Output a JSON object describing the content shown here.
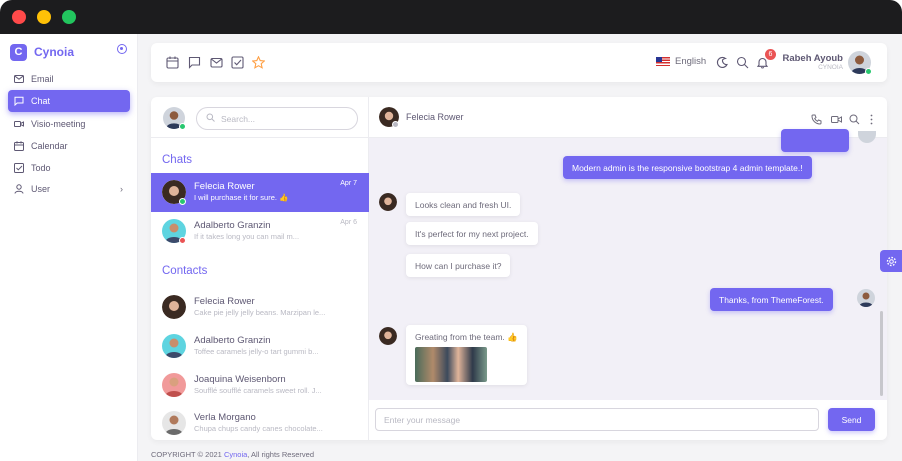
{
  "sidebar": {
    "brand": "Cynoia",
    "brand_mark": "C",
    "items": [
      {
        "label": "Email",
        "icon": "mail-icon"
      },
      {
        "label": "Chat",
        "icon": "chat-icon"
      },
      {
        "label": "Visio-meeting",
        "icon": "video-icon"
      },
      {
        "label": "Calendar",
        "icon": "calendar-icon"
      },
      {
        "label": "Todo",
        "icon": "check-square-icon"
      },
      {
        "label": "User",
        "icon": "user-icon"
      }
    ]
  },
  "header": {
    "language": "English",
    "notification_count": "6",
    "user_name": "Rabeh Ayoub",
    "user_role": "CYNOIA"
  },
  "chat_list": {
    "search_placeholder": "Search...",
    "chats_title": "Chats",
    "contacts_title": "Contacts",
    "chats": [
      {
        "name": "Felecia Rower",
        "preview": "I will purchase it for sure. 👍",
        "time": "Apr 7",
        "status": "online"
      },
      {
        "name": "Adalberto Granzin",
        "preview": "If it takes long you can mail m...",
        "time": "Apr 6",
        "status": "busy"
      }
    ],
    "contacts": [
      {
        "name": "Felecia Rower",
        "preview": "Cake pie jelly jelly beans. Marzipan le..."
      },
      {
        "name": "Adalberto Granzin",
        "preview": "Toffee caramels jelly-o tart gummi b..."
      },
      {
        "name": "Joaquina Weisenborn",
        "preview": "Soufflé soufflé caramels sweet roll. J..."
      },
      {
        "name": "Verla Morgano",
        "preview": "Chupa chups candy canes chocolate..."
      }
    ]
  },
  "conversation": {
    "contact_name": "Felecia Rower",
    "messages": [
      {
        "text": "Modern admin is the responsive bootstrap 4 admin template.!",
        "dir": "out"
      },
      {
        "text": "Looks clean and fresh UI.",
        "dir": "in"
      },
      {
        "text": "It's perfect for my next project.",
        "dir": "in"
      },
      {
        "text": "How can I purchase it?",
        "dir": "in"
      },
      {
        "text": "Thanks, from ThemeForest.",
        "dir": "out"
      },
      {
        "text": "Greating from the team. 👍",
        "dir": "in"
      }
    ],
    "input_placeholder": "Enter your message",
    "send_label": "Send"
  },
  "footer": {
    "prefix": "COPYRIGHT © 2021",
    "brand": "Cynoia",
    "suffix": ", All rights Reserved"
  },
  "colors": {
    "accent": "#7367f0",
    "online": "#28c76f",
    "busy": "#ea5455"
  }
}
